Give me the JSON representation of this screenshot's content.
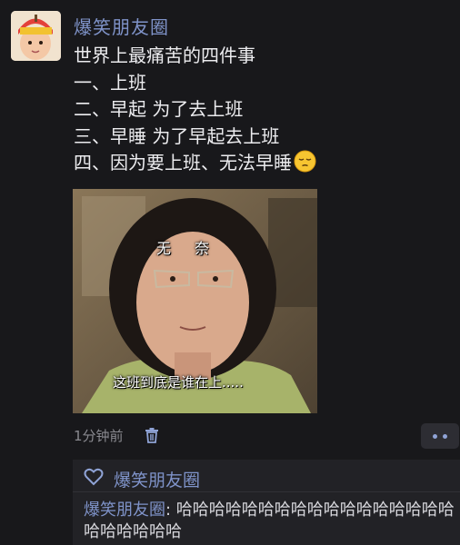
{
  "post": {
    "author": "爆笑朋友圈",
    "lines": [
      "世界上最痛苦的四件事",
      "一、上班",
      "二、早起 为了去上班",
      "三、早睡 为了早起去上班",
      "四、因为要上班、无法早睡"
    ],
    "emoji": "pensive-face-emoji",
    "image": {
      "caption_top": "无奈",
      "caption_bottom": "这班到底是谁在上....."
    },
    "time": "1分钟前"
  },
  "likes": {
    "names": "爆笑朋友圈"
  },
  "comments": [
    {
      "name": "爆笑朋友圈",
      "separator": ": ",
      "text": "哈哈哈哈哈哈哈哈哈哈哈哈哈哈哈哈哈哈哈哈哈哈哈"
    }
  ],
  "colors": {
    "background": "#18181b",
    "link": "#7f93c9",
    "comment_bg": "#222226"
  }
}
